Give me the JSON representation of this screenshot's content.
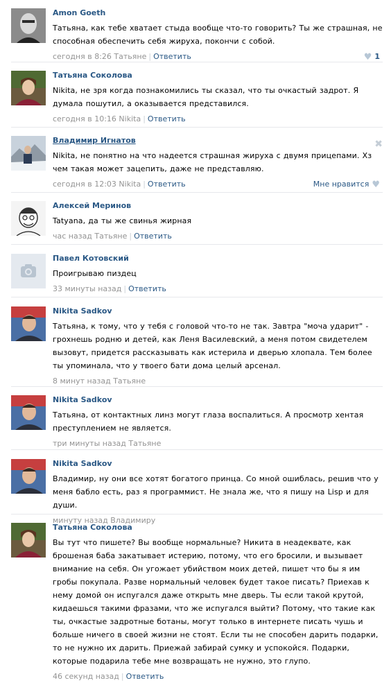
{
  "comments": [
    {
      "author": "Amon Goeth",
      "text": "Татьяна, как тебе хватает стыда вообще что-то говорить? Ты же страшная, не способная обеспечить себя жируха, покончи с собой.",
      "time": "сегодня в 8:26",
      "reply_to": "Татьяне",
      "reply_label": "Ответить",
      "likes": "1"
    },
    {
      "author": "Татьяна Соколова",
      "text": "Nikita, не зря когда познакомились ты сказал, что ты очкастый задрот. Я думала пошутил, а оказывается представился.",
      "time": "сегодня в 10:16",
      "reply_to": "Nikita",
      "reply_label": "Ответить"
    },
    {
      "author": "Владимир Игнатов",
      "text": "Nikita, не понятно на что надеется страшная жируха с двумя прицепами. Хз чем такая может зацепить, даже не представляю.",
      "time": "сегодня в 12:03",
      "reply_to": "Nikita",
      "reply_label": "Ответить",
      "like_label": "Мне нравится"
    },
    {
      "author": "Алексей Меринов",
      "text": "Tatyana, да ты же свинья жирная",
      "time": "час назад",
      "reply_to": "Татьяне",
      "reply_label": "Ответить"
    },
    {
      "author": "Павел Котовский",
      "text": "Проигрываю пиздец",
      "time": "33 минуты назад",
      "reply_label": "Ответить"
    },
    {
      "author": "Nikita Sadkov",
      "text": "Татьяна, к тому, что у тебя с головой что-то не так. Завтра \"моча ударит\" - грохнешь родню и детей, как Леня Василевский, а меня потом свидетелем вызовут, придется рассказывать как истерила и дверью хлопала. Тем более ты упоминала, что у твоего бати дома целый арсенал.",
      "time": "8 минут назад",
      "reply_to": "Татьяне"
    },
    {
      "author": "Nikita Sadkov",
      "text": "Татьяна, от контактных линз могут глаза воспалиться. А просмотр хентая преступлением не является.",
      "time": "три минуты назад",
      "reply_to": "Татьяне"
    },
    {
      "author": "Nikita Sadkov",
      "text": "Владимир, ну они все хотят богатого принца. Со мной ошиблась, решив что у меня бабло есть, раз я программист. Не знала же, что я пишу на Lisp и для души.",
      "time": "минуту назад",
      "reply_to": "Владимиру"
    },
    {
      "author": "Татьяна Соколова",
      "text": "Вы тут что пишете? Вы вообще нормальные? Никита в неадеквате, как брошеная баба закатывает истерию, потому, что его бросили, и вызывает внимание на себя. Он угожает убийством моих детей, пишет что бы я им гробы покупала. Разве нормальный человек будет такое писать? Приехав к нему домой он испугался даже открыть мне дверь. Ты если такой крутой, кидаешься такими фразами, что же испугался выйти? Потому, что такие как ты, очкастые задротные ботаны, могут только в интернете писать чушь и больше ничего в своей жизни не стоят. Если ты не способен дарить подарки, то не нужно их дарить. Приежай забирай сумку и успокойся. Подарки, которые подарила тебе мне возвращать не нужно, это глупо.",
      "time": "46 секунд назад",
      "reply_label": "Ответить"
    }
  ]
}
